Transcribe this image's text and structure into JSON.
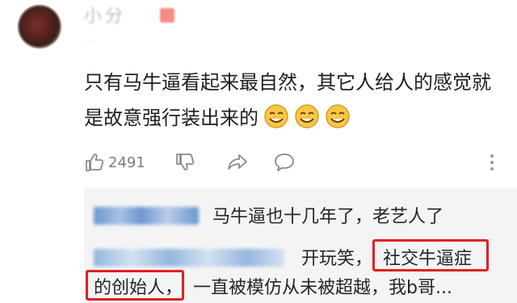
{
  "comment": {
    "username_obscured": "小分",
    "meta_obscured": "··",
    "text": "只有马牛逼看起来最自然，其它人给人的感觉就是故意强行装出来的",
    "emoji_name": "smiling-face-emoji",
    "emoji_count": 3,
    "likes": "2491",
    "icons": [
      "thumbs-up-icon",
      "thumbs-down-icon",
      "share-icon",
      "comment-bubble-icon",
      "more-vertical-icon"
    ]
  },
  "replies": [
    {
      "text": "马牛逼也十几年了，老艺人了"
    },
    {
      "text_before_highlight": "开玩笑，",
      "highlight_1": "社交牛逼症",
      "highlight_2": "的创始人，",
      "text_after": "一直被模仿从未被超越，我b哥..."
    }
  ],
  "colors": {
    "highlight_border": "#e02020",
    "reply_background": "#f4f4f4",
    "secondary_text": "#7c7c7c",
    "emoji_fill": "#f7c846"
  }
}
